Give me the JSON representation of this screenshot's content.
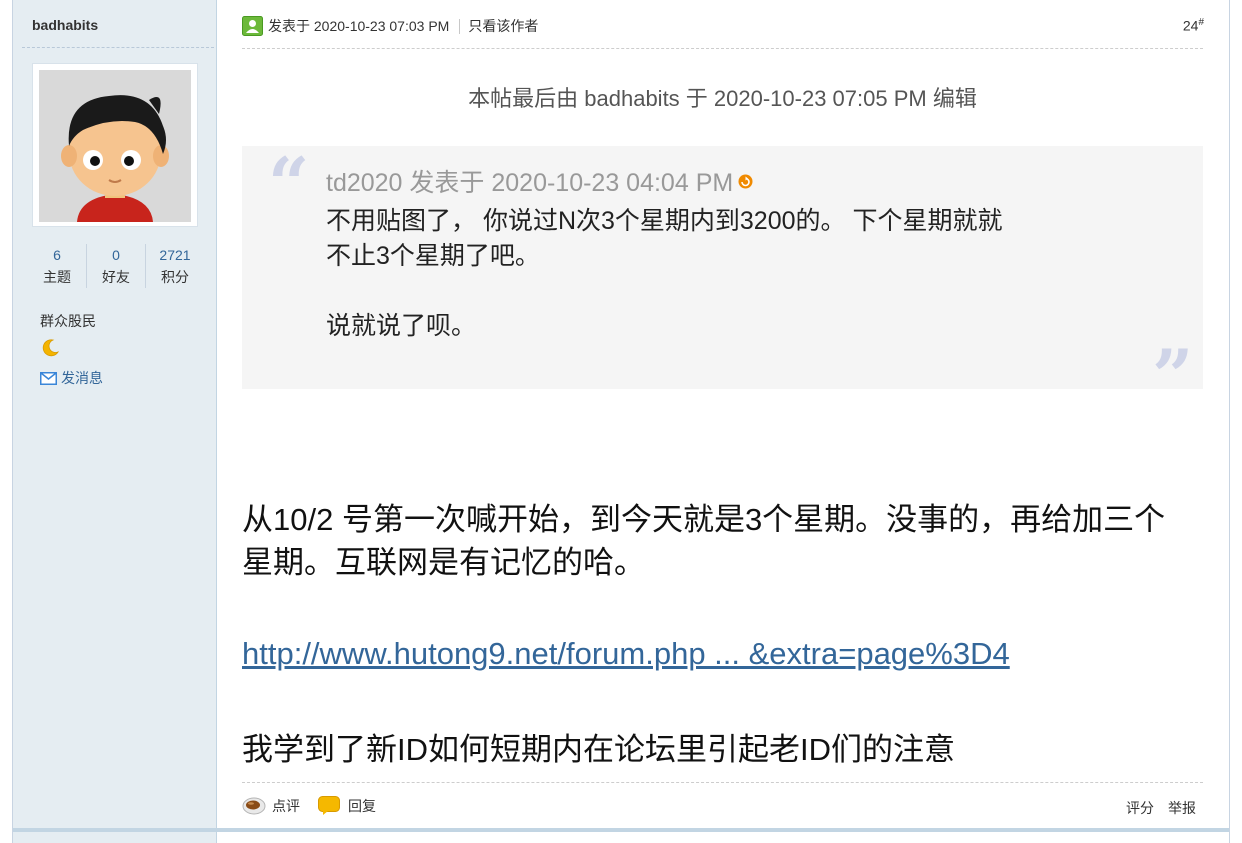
{
  "author": {
    "username": "badhabits",
    "stats": [
      {
        "value": "6",
        "label": "主题"
      },
      {
        "value": "0",
        "label": "好友"
      },
      {
        "value": "2721",
        "label": "积分"
      }
    ],
    "group": "群众股民",
    "message_label": "发消息"
  },
  "post": {
    "posted_at": "发表于 2020-10-23 07:03 PM",
    "only_author": "只看该作者",
    "floor_number": "24",
    "floor_sup": "#",
    "edit_note": "本帖最后由 badhabits 于 2020-10-23 07:05 PM 编辑",
    "quote": {
      "author_line": "td2020 发表于 2020-10-23 04:04 PM",
      "line1": "不用贴图了， 你说过N次3个星期内到3200的。 下个星期就就",
      "line2": "不止3个星期了吧。",
      "line3": "说就说了呗。"
    },
    "body_line1": "从10/2 号第一次喊开始，到今天就是3个星期。没事的，再给加三个",
    "body_line2": "星期。互联网是有记忆的哈。",
    "link_text": "http://www.hutong9.net/forum.php ... &extra=page%3D4",
    "last_line": "我学到了新ID如何短期内在论坛里引起老ID们的注意"
  },
  "footer": {
    "comment_label": "点评",
    "reply_label": "回复",
    "rate_label": "评分",
    "report_label": "举报"
  },
  "colors": {
    "sidebar_bg": "#e5edf2",
    "link": "#336699",
    "quote_bg": "#f5f5f5"
  }
}
